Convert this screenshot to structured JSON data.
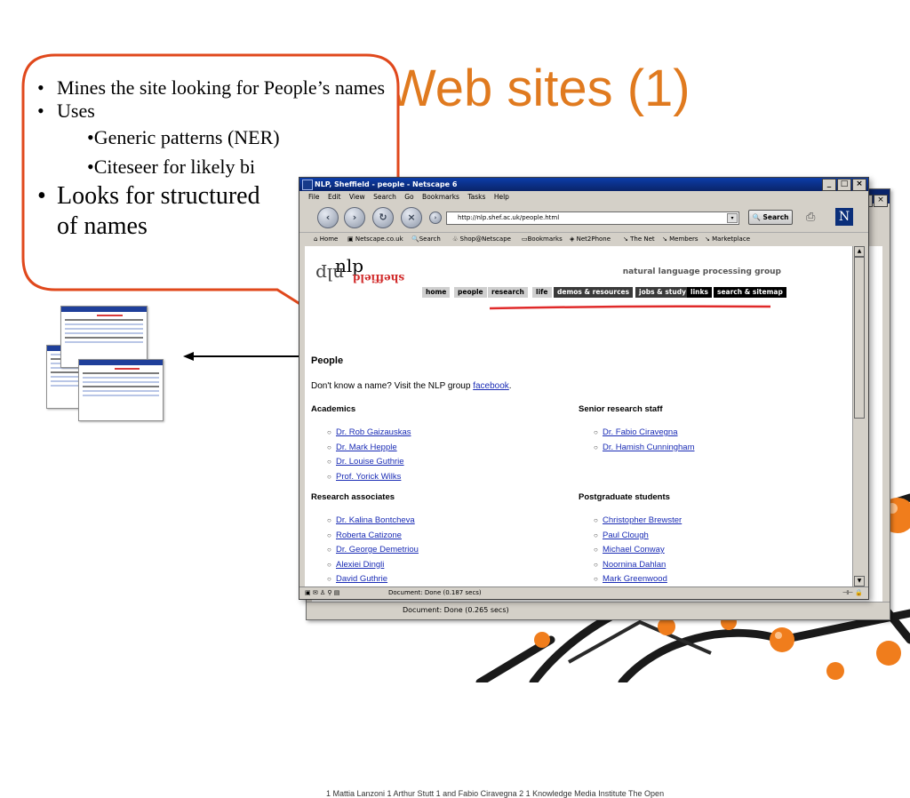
{
  "slide": {
    "title": "Web sites (1)"
  },
  "callout": {
    "bullets": [
      {
        "text": "Mines the site looking for People’s names"
      },
      {
        "text": "Uses"
      }
    ],
    "sub_bullets": [
      {
        "text": "•Generic patterns (NER)"
      },
      {
        "text": "•Citeseer for likely bi"
      }
    ],
    "big_bullet": "Looks for structured",
    "big_bullet_cont": "of names"
  },
  "back_window": {
    "status": "Document: Done (0.265 secs)",
    "peek_text": "1 Mattia Lanzoni 1 Arthur Stutt 1 and Fabio Ciravegna 2 1 Knowledge Media Institute The Open"
  },
  "browser": {
    "title": "NLP, Sheffield - people - Netscape 6",
    "menu": [
      "File",
      "Edit",
      "View",
      "Search",
      "Go",
      "Bookmarks",
      "Tasks",
      "Help"
    ],
    "url": "http://nlp.shef.ac.uk/people.html",
    "search_label": "Search",
    "logo_letter": "N",
    "personal_toolbar": [
      "Home",
      "Netscape.co.uk",
      "Search",
      "Shop@Netscape",
      "Bookmarks",
      "Net2Phone",
      "The Net",
      "Members",
      "Marketplace"
    ],
    "status": "Document: Done (0.187 secs)"
  },
  "site": {
    "logo_top": "nlp",
    "logo_bottom": "nlp",
    "logo_red": "sheffield",
    "tagline": "natural language processing group",
    "nav": [
      "home",
      "people",
      "research",
      "life",
      "demos & resources",
      "jobs & study",
      "links",
      "search & sitemap"
    ],
    "heading": "People",
    "intro_text": "Don't know a name? Visit the NLP group ",
    "intro_link": "facebook",
    "intro_end": ".",
    "academics": {
      "title": "Academics",
      "people": [
        "Dr. Rob Gaizauskas",
        "Dr. Mark Hepple",
        "Dr. Louise Guthrie",
        "Prof. Yorick Wilks"
      ]
    },
    "senior": {
      "title": "Senior research staff",
      "people": [
        "Dr. Fabio Ciravegna",
        "Dr. Hamish Cunningham"
      ]
    },
    "research_associates": {
      "title": "Research associates",
      "people": [
        "Dr. Kalina Bontcheva",
        "Roberta Catizone",
        "Dr. George Demetriou",
        "Alexiei Dingli",
        "David Guthrie"
      ]
    },
    "postgrads": {
      "title": "Postgraduate students",
      "people": [
        "Christopher Brewster",
        "Paul Clough",
        "Michael Conway",
        "Noornina Dahlan",
        "Mark Greenwood"
      ]
    }
  },
  "colors": {
    "title_orange": "#e07a1f",
    "callout_border": "#e0481c",
    "link_blue": "#1a2cb5",
    "titlebar_blue": "#0a246a"
  }
}
